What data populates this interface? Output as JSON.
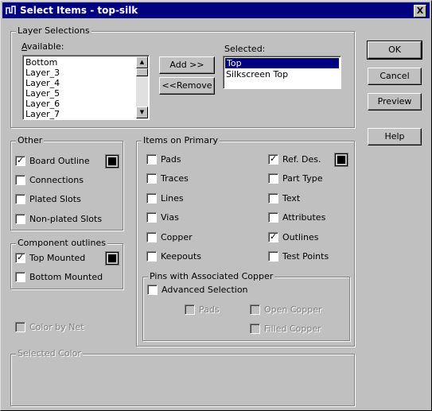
{
  "window": {
    "title": "Select Items - top-silk",
    "close": "X"
  },
  "layer_selections": {
    "legend": "Layer Selections",
    "available_label": "Available:",
    "available": [
      "Bottom",
      "Layer_3",
      "Layer_4",
      "Layer_5",
      "Layer_6",
      "Layer_7"
    ],
    "selected_label": "Selected:",
    "selected": [
      "Top",
      "Silkscreen Top"
    ],
    "selected_active": "Top",
    "add_button": "Add >>",
    "remove_button": "<<Remove"
  },
  "buttons": {
    "ok": "OK",
    "cancel": "Cancel",
    "preview": "Preview",
    "help": "Help"
  },
  "other": {
    "legend": "Other",
    "board_outline": {
      "label": "Board Outline",
      "checked": true
    },
    "connections": {
      "label": "Connections",
      "checked": false
    },
    "plated_slots": {
      "label": "Plated Slots",
      "checked": false
    },
    "nonplated_slots": {
      "label": "Non-plated Slots",
      "checked": false
    }
  },
  "component_outlines": {
    "legend": "Component outlines",
    "top_mounted": {
      "label": "Top Mounted",
      "checked": true
    },
    "bottom_mounted": {
      "label": "Bottom Mounted",
      "checked": false
    }
  },
  "color_by_net": {
    "label": "Color by Net",
    "checked": false,
    "disabled": true
  },
  "items_on_primary": {
    "legend": "Items on Primary",
    "pads": "Pads",
    "traces": "Traces",
    "lines": "Lines",
    "vias": "Vias",
    "copper": "Copper",
    "keepouts": "Keepouts",
    "ref_des": "Ref. Des.",
    "part_type": "Part Type",
    "text": "Text",
    "attributes": "Attributes",
    "outlines": "Outlines",
    "test_points": "Test Points",
    "checked": [
      "ref_des",
      "outlines"
    ]
  },
  "pins_assoc": {
    "legend": "Pins with Associated Copper",
    "advanced": "Advanced Selection",
    "pads": "Pads",
    "open_copper": "Open Copper",
    "filled_copper": "Filled Copper"
  },
  "selected_color": {
    "legend": "Selected Color"
  },
  "colors": {
    "titlebar": "#000080",
    "face": "#c0c0c0",
    "selection": "#000080"
  }
}
